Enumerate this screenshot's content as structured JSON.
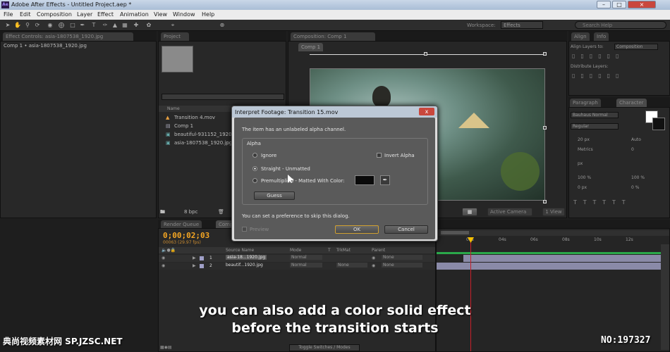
{
  "window": {
    "title": "Adobe After Effects - Untitled Project.aep *",
    "app_icon": "Ae"
  },
  "menu": [
    "File",
    "Edit",
    "Composition",
    "Layer",
    "Effect",
    "Animation",
    "View",
    "Window",
    "Help"
  ],
  "toolbar": {
    "workspace_label": "Workspace:",
    "workspace_value": "Effects",
    "search_placeholder": "Search Help"
  },
  "effect_controls": {
    "tab": "Effect Controls: asia-1807538_1920.jpg",
    "path": "Comp 1 • asia-1807538_1920.jpg"
  },
  "project": {
    "tab": "Project",
    "column_name": "Name",
    "items": [
      "Transition 4.mov",
      "Comp 1",
      "beautiful-931152_1920.jpg",
      "asia-1807538_1920.jpg"
    ],
    "bpc": "8 bpc"
  },
  "composition": {
    "tab": "Composition: Comp 1",
    "subtab": "Comp 1",
    "camera": "Active Camera",
    "view": "1 View"
  },
  "align": {
    "tab1": "Align",
    "tab2": "Info",
    "align_layers_to": "Align Layers to:",
    "align_value": "Composition",
    "distribute": "Distribute Layers:"
  },
  "paragraph": {
    "tab1": "Paragraph",
    "tab2": "Character",
    "font": "Bauhaus Normal",
    "style": "Regular",
    "size": "20 px",
    "leading": "Auto",
    "kerning": "Metrics",
    "tracking": "0",
    "stroke": "px",
    "vscale": "100 %",
    "hscale": "100 %",
    "baseline": "0 px",
    "tsume": "0 %"
  },
  "timeline": {
    "tab1": "Render Queue",
    "tab2": "Comp 1",
    "timecode": "0;00;02;03",
    "frames": "00063 (29.97 fps)",
    "col_source": "Source Name",
    "col_mode": "Mode",
    "col_t": "T",
    "col_trkmat": "TrkMat",
    "col_parent": "Parent",
    "layers": [
      {
        "num": "1",
        "name": "asia-18...1920.jpg",
        "mode": "Normal",
        "trkmat": "",
        "parent": "None"
      },
      {
        "num": "2",
        "name": "beautif...1920.jpg",
        "mode": "Normal",
        "trkmat": "None",
        "parent": "None"
      }
    ],
    "ruler": [
      "02s",
      "04s",
      "06s",
      "08s",
      "10s",
      "12s"
    ],
    "toggle": "Toggle Switches / Modes"
  },
  "dialog": {
    "title": "Interpret Footage: Transition 15.mov",
    "message": "The item has an unlabeled alpha channel.",
    "group": "Alpha",
    "opt_ignore": "Ignore",
    "opt_invert": "Invert Alpha",
    "opt_straight": "Straight - Unmatted",
    "opt_premult": "Premultiplied - Matted With Color:",
    "guess": "Guess",
    "footnote": "You can set a preference to skip this dialog.",
    "preview": "Preview",
    "ok": "OK",
    "cancel": "Cancel",
    "close": "x"
  },
  "subtitles": {
    "line1": "you can also add a color solid effect",
    "line2": "before the transition starts"
  },
  "watermark": {
    "left": "典尚视频素材网 SP.JZSC.NET",
    "right": "NO:197327"
  },
  "colors": {
    "accent_timecode": "#f5a623",
    "playhead": "#c8202a",
    "dialog_bg": "#dcdcdc",
    "panel_bg": "#282828"
  }
}
